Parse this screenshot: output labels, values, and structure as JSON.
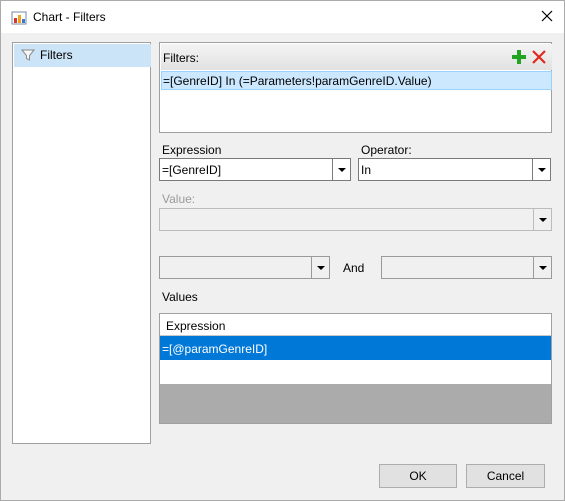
{
  "window": {
    "title": "Chart - Filters"
  },
  "sidebar": {
    "items": [
      {
        "label": "Filters"
      }
    ]
  },
  "filters": {
    "header": "Filters:",
    "rows": [
      "=[GenreID] In (=Parameters!paramGenreID.Value)"
    ]
  },
  "expression": {
    "label": "Expression",
    "value": "=[GenreID]"
  },
  "operator": {
    "label": "Operator:",
    "value": "In"
  },
  "value_field": {
    "label": "Value:",
    "value": ""
  },
  "range": {
    "and_label": "And",
    "from_value": "",
    "to_value": ""
  },
  "values": {
    "label": "Values",
    "column_header": "Expression",
    "rows": [
      "=[@paramGenreID]"
    ]
  },
  "buttons": {
    "ok": "OK",
    "cancel": "Cancel"
  },
  "colors": {
    "selection": "#0078d7",
    "filter_row_highlight": "#cce8ff",
    "sidebar_selected": "#cce4f7",
    "add_icon": "#22a322",
    "delete_icon": "#e0281c"
  }
}
